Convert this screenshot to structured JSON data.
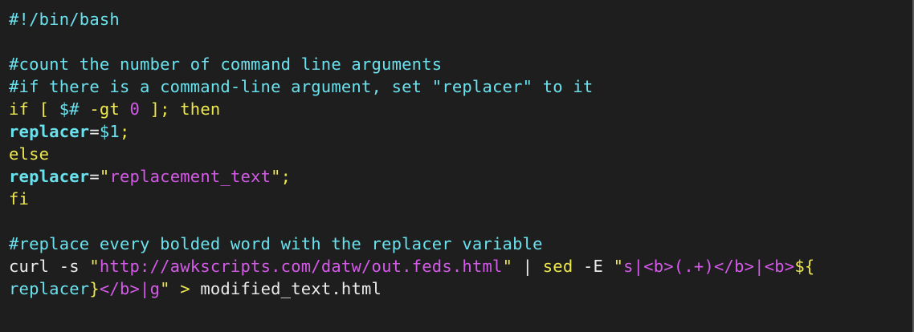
{
  "colors": {
    "background": "#1e1e1e",
    "comment": "#6ae2ee",
    "keyword": "#eee84d",
    "plain": "#ececec",
    "string": "#d45ae8"
  },
  "lines": [
    [
      {
        "text": "#!/bin/bash",
        "style": "c-cyan"
      }
    ],
    [],
    [
      {
        "text": "#count the number of command line arguments",
        "style": "c-cyan"
      }
    ],
    [
      {
        "text": "#if there is a command-line argument, set \"replacer\" to it",
        "style": "c-cyan"
      }
    ],
    [
      {
        "text": "if [ ",
        "style": "c-yellow"
      },
      {
        "text": "$#",
        "style": "c-cyan"
      },
      {
        "text": " -gt ",
        "style": "c-yellow"
      },
      {
        "text": "0",
        "style": "c-magenta"
      },
      {
        "text": " ]; then",
        "style": "c-yellow"
      }
    ],
    [
      {
        "text": "replacer",
        "style": "c-cyan bold"
      },
      {
        "text": "=",
        "style": "c-white"
      },
      {
        "text": "$1",
        "style": "c-cyan"
      },
      {
        "text": ";",
        "style": "c-yellow"
      }
    ],
    [
      {
        "text": "else",
        "style": "c-yellow"
      }
    ],
    [
      {
        "text": "replacer",
        "style": "c-cyan bold"
      },
      {
        "text": "=",
        "style": "c-white"
      },
      {
        "text": "\"",
        "style": "c-yellow"
      },
      {
        "text": "replacement_text",
        "style": "c-magenta"
      },
      {
        "text": "\";",
        "style": "c-yellow"
      }
    ],
    [
      {
        "text": "fi",
        "style": "c-yellow"
      }
    ],
    [],
    [
      {
        "text": "#replace every bolded word with the replacer variable",
        "style": "c-cyan"
      }
    ],
    [
      {
        "text": "curl -s ",
        "style": "c-white"
      },
      {
        "text": "\"",
        "style": "c-yellow"
      },
      {
        "text": "http://awkscripts.com/datw/out.feds.html",
        "style": "c-magenta"
      },
      {
        "text": "\"",
        "style": "c-yellow"
      },
      {
        "text": " | ",
        "style": "c-white"
      },
      {
        "text": "sed",
        "style": "c-yellow"
      },
      {
        "text": " -E ",
        "style": "c-white"
      },
      {
        "text": "\"",
        "style": "c-yellow"
      },
      {
        "text": "s|<b>(.+)</b>|<b>",
        "style": "c-magenta"
      },
      {
        "text": "${",
        "style": "c-yellow"
      }
    ],
    [
      {
        "text": "replacer",
        "style": "c-cyan"
      },
      {
        "text": "}",
        "style": "c-yellow"
      },
      {
        "text": "</b>|g",
        "style": "c-magenta"
      },
      {
        "text": "\"",
        "style": "c-yellow"
      },
      {
        "text": " > ",
        "style": "c-yellow"
      },
      {
        "text": "modified_text.html",
        "style": "c-white"
      }
    ]
  ]
}
